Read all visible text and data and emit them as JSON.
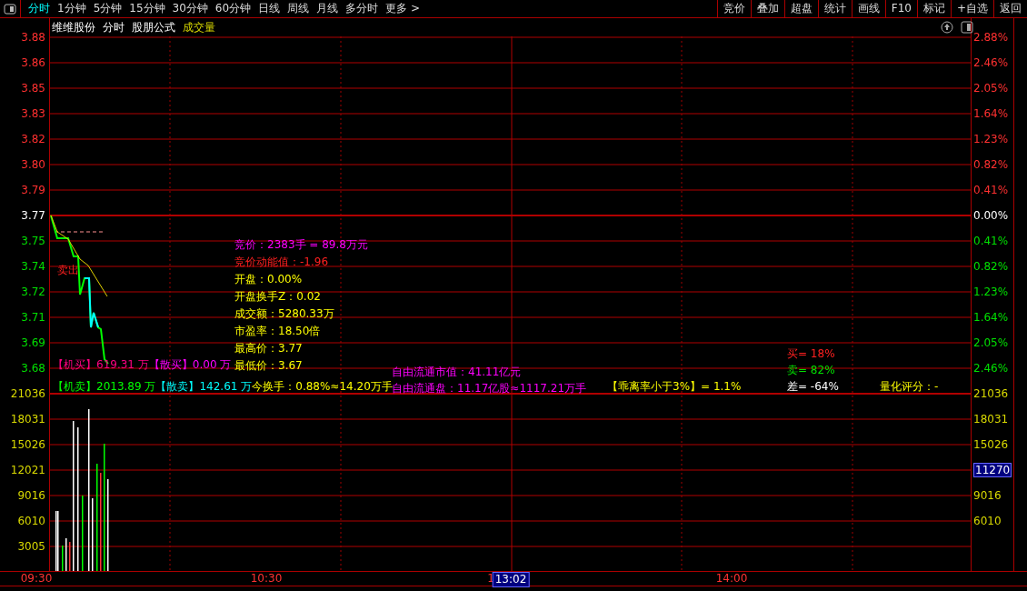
{
  "toolbar": {
    "periods": [
      {
        "label": "分时",
        "selected": true
      },
      {
        "label": "1分钟",
        "selected": false
      },
      {
        "label": "5分钟",
        "selected": false
      },
      {
        "label": "15分钟",
        "selected": false
      },
      {
        "label": "30分钟",
        "selected": false
      },
      {
        "label": "60分钟",
        "selected": false
      },
      {
        "label": "日线",
        "selected": false
      },
      {
        "label": "周线",
        "selected": false
      },
      {
        "label": "月线",
        "selected": false
      },
      {
        "label": "多分时",
        "selected": false
      },
      {
        "label": "更多 >",
        "selected": false
      }
    ],
    "actions": [
      "竞价",
      "叠加",
      "超盘",
      "统计",
      "画线",
      "F10",
      "标记",
      "+自选",
      "返回"
    ]
  },
  "chart_title": {
    "stock": "维维股份",
    "period": "分时",
    "formula": "股朋公式",
    "indicator": "成交量"
  },
  "price_axis": [
    {
      "label": "3.88",
      "color": "#ff3030"
    },
    {
      "label": "3.86",
      "color": "#ff3030"
    },
    {
      "label": "3.85",
      "color": "#ff3030"
    },
    {
      "label": "3.83",
      "color": "#ff3030"
    },
    {
      "label": "3.82",
      "color": "#ff3030"
    },
    {
      "label": "3.80",
      "color": "#ff3030"
    },
    {
      "label": "3.79",
      "color": "#ff3030"
    },
    {
      "label": "3.77",
      "color": "#ffffff"
    },
    {
      "label": "3.75",
      "color": "#00e000"
    },
    {
      "label": "3.74",
      "color": "#00e000"
    },
    {
      "label": "3.72",
      "color": "#00e000"
    },
    {
      "label": "3.71",
      "color": "#00e000"
    },
    {
      "label": "3.69",
      "color": "#00e000"
    },
    {
      "label": "3.68",
      "color": "#00e000"
    }
  ],
  "volume_axis": [
    "21036",
    "18031",
    "15026",
    "12021",
    "9016",
    "6010",
    "3005"
  ],
  "percent_axis": [
    {
      "label": "2.88%",
      "color": "#ff3030"
    },
    {
      "label": "2.46%",
      "color": "#ff3030"
    },
    {
      "label": "2.05%",
      "color": "#ff3030"
    },
    {
      "label": "1.64%",
      "color": "#ff3030"
    },
    {
      "label": "1.23%",
      "color": "#ff3030"
    },
    {
      "label": "0.82%",
      "color": "#ff3030"
    },
    {
      "label": "0.41%",
      "color": "#ff3030"
    },
    {
      "label": "0.00%",
      "color": "#ffffff"
    },
    {
      "label": "0.41%",
      "color": "#00e000"
    },
    {
      "label": "0.82%",
      "color": "#00e000"
    },
    {
      "label": "1.23%",
      "color": "#00e000"
    },
    {
      "label": "1.64%",
      "color": "#00e000"
    },
    {
      "label": "2.05%",
      "color": "#00e000"
    },
    {
      "label": "2.46%",
      "color": "#00e000"
    }
  ],
  "right_volume_axis": [
    {
      "label": "21036",
      "kind": "tick"
    },
    {
      "label": "18031",
      "kind": "tick"
    },
    {
      "label": "15026",
      "kind": "tick"
    },
    {
      "label": "11270",
      "kind": "cursor"
    },
    {
      "label": "9016",
      "kind": "tick"
    },
    {
      "label": "6010",
      "kind": "tick"
    }
  ],
  "signal_label": "卖出",
  "auction_info": [
    {
      "text": "竞价：2383手 = 89.8万元",
      "color": "#ff00ff"
    },
    {
      "text": "竞价动能值：-1.96",
      "color": "#ff2020"
    },
    {
      "text": "开盘：0.00%",
      "color": "#ffff00"
    },
    {
      "text": "开盘换手Z：0.02",
      "color": "#ffff00"
    },
    {
      "text": "成交额：5280.33万",
      "color": "#ffff00"
    },
    {
      "text": "市盈率：18.50倍",
      "color": "#ffff00"
    },
    {
      "text": "最高价：3.77",
      "color": "#ffff00"
    },
    {
      "text": "最低价：3.67",
      "color": "#ffff00"
    }
  ],
  "buy_line": [
    {
      "text": "【机买】619.31 万",
      "color": "#ff0080"
    },
    {
      "text": "【散买】0.00 万",
      "color": "#ff00ff"
    }
  ],
  "sell_line": [
    {
      "text": "【机卖】2013.89 万",
      "color": "#00ff00"
    },
    {
      "text": "【散卖】142.61 万",
      "color": "#00ffff"
    },
    {
      "text": "今换手：0.88%≈14.20万手",
      "color": "#ffff00"
    }
  ],
  "float_info": [
    {
      "text": "自由流通市值：41.11亿元",
      "color": "#ff00ff"
    },
    {
      "text": "自由流通盘：11.17亿股≈1117.21万手",
      "color": "#ff00ff"
    }
  ],
  "deviation": "【乖离率小于3%】= 1.1%",
  "ratio": [
    {
      "text": "买= 18%",
      "color": "#ff2020"
    },
    {
      "text": "卖= 82%",
      "color": "#00e000"
    },
    {
      "text": "差= -64%",
      "color": "#ffffff"
    }
  ],
  "score": "量化评分：-",
  "time_axis": [
    {
      "label": "09:30",
      "kind": "tick"
    },
    {
      "label": "10:30",
      "kind": "tick"
    },
    {
      "label": "1",
      "kind": "tick"
    },
    {
      "label": "13:02",
      "kind": "cursor"
    },
    {
      "label": "14:00",
      "kind": "tick"
    }
  ]
}
